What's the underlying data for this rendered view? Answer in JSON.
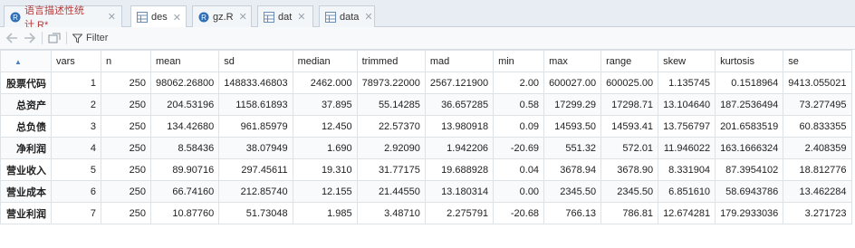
{
  "tabs": [
    {
      "label": "语言描述性统计.R*",
      "icon": "r-script-icon",
      "active": false,
      "modified": true
    },
    {
      "label": "des",
      "icon": "table-icon",
      "active": true,
      "modified": false
    },
    {
      "label": "gz.R",
      "icon": "r-script-icon",
      "active": false,
      "modified": false
    },
    {
      "label": "dat",
      "icon": "table-icon",
      "active": false,
      "modified": false
    },
    {
      "label": "data",
      "icon": "table-icon",
      "active": false,
      "modified": false
    }
  ],
  "toolbar": {
    "filter_label": "Filter"
  },
  "table": {
    "columns": [
      "vars",
      "n",
      "mean",
      "sd",
      "median",
      "trimmed",
      "mad",
      "min",
      "max",
      "range",
      "skew",
      "kurtosis",
      "se"
    ],
    "rows": [
      {
        "name": "股票代码",
        "cells": [
          "1",
          "250",
          "98062.26800",
          "148833.46803",
          "2462.000",
          "78973.22000",
          "2567.121900",
          "2.00",
          "600027.00",
          "600025.00",
          "1.135745",
          "0.1518964",
          "9413.055021"
        ]
      },
      {
        "name": "总资产",
        "cells": [
          "2",
          "250",
          "204.53196",
          "1158.61893",
          "37.895",
          "55.14285",
          "36.657285",
          "0.58",
          "17299.29",
          "17298.71",
          "13.104640",
          "187.2536494",
          "73.277495"
        ]
      },
      {
        "name": "总负债",
        "cells": [
          "3",
          "250",
          "134.42680",
          "961.85979",
          "12.450",
          "22.57370",
          "13.980918",
          "0.09",
          "14593.50",
          "14593.41",
          "13.756797",
          "201.6583519",
          "60.833355"
        ]
      },
      {
        "name": "净利润",
        "cells": [
          "4",
          "250",
          "8.58436",
          "38.07949",
          "1.690",
          "2.92090",
          "1.942206",
          "-20.69",
          "551.32",
          "572.01",
          "11.946022",
          "163.1666324",
          "2.408359"
        ]
      },
      {
        "name": "营业收入",
        "cells": [
          "5",
          "250",
          "89.90716",
          "297.45611",
          "19.310",
          "31.77175",
          "19.688928",
          "0.04",
          "3678.94",
          "3678.90",
          "8.331904",
          "87.3954102",
          "18.812776"
        ]
      },
      {
        "name": "营业成本",
        "cells": [
          "6",
          "250",
          "66.74160",
          "212.85740",
          "12.155",
          "21.44550",
          "13.180314",
          "0.00",
          "2345.50",
          "2345.50",
          "6.851610",
          "58.6943786",
          "13.462284"
        ]
      },
      {
        "name": "营业利润",
        "cells": [
          "7",
          "250",
          "10.87760",
          "51.73048",
          "1.985",
          "3.48710",
          "2.275791",
          "-20.68",
          "766.13",
          "786.81",
          "12.674281",
          "179.2933036",
          "3.271723"
        ]
      }
    ]
  }
}
